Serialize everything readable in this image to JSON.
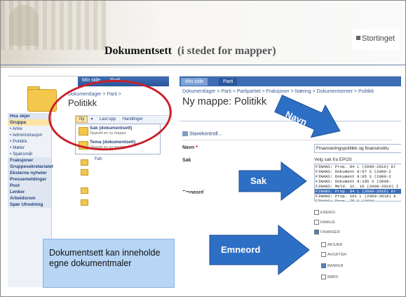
{
  "header": {
    "brand": "Stortinget",
    "title": "Dokumentsett",
    "subtitle": "(i stedet for mapper)"
  },
  "left_screenshot": {
    "tabs": [
      "Min side",
      "Parti"
    ],
    "breadcrumb": "Dokumentlager > Parti >",
    "page_title": "Politikk",
    "nav": [
      {
        "label": "Hva skjer",
        "kind": "head"
      },
      {
        "label": "Gruppa",
        "kind": "selected"
      },
      {
        "label": "• Arkiv",
        "kind": "item"
      },
      {
        "label": "• Administrasjon",
        "kind": "item"
      },
      {
        "label": "• Politikk",
        "kind": "item"
      },
      {
        "label": "• Møter",
        "kind": "item"
      },
      {
        "label": "• Spørsmål",
        "kind": "item"
      },
      {
        "label": "Fraksjoner",
        "kind": "head"
      },
      {
        "label": "Gruppesekretariatet",
        "kind": "head"
      },
      {
        "label": "Eksterne nyheter",
        "kind": "head"
      },
      {
        "label": "Pressemeldinger",
        "kind": "head"
      },
      {
        "label": "Post",
        "kind": "head"
      },
      {
        "label": "Lenker",
        "kind": "head"
      },
      {
        "label": "Arbeidsrom",
        "kind": "head"
      },
      {
        "label": "Spør Utredning",
        "kind": "head"
      }
    ],
    "toolbar": {
      "new": "Ny",
      "upload": "Last opp",
      "actions": "Handlinger"
    },
    "menu": [
      {
        "label": "Sak (dokumentsett)",
        "desc": "Opprett en ny mappe."
      },
      {
        "label": "Tema (dokumentsett)",
        "desc": "Opprett en ny mappe."
      }
    ],
    "list_header": "Felt"
  },
  "callout": {
    "text": "Dokumentsett kan inneholde egne dokumentmaler"
  },
  "right_screenshot": {
    "tabs": [
      "Min side",
      "Parti"
    ],
    "breadcrumb": "Dokumentlager > Parti > Partipartiet > Fraksjoner > Næring > Dokumentsenter > Politikk",
    "page_title": "Ny mappe: Politikk",
    "spellcheck": "Stavekontroll...",
    "fields": {
      "navn_label": "Navn",
      "navn_required": "*",
      "navn_value": "Finansieringspolitikk og finansinstitu",
      "sak_label": "Sak",
      "sak_hint": "Velg sak fra EPOS",
      "sak_items": [
        {
          "text": "FINANS: Prop. 84 L (2009-2010) Er",
          "selected": false
        },
        {
          "text": "FINANS: Dokument 8:67 S (2009-2",
          "selected": false
        },
        {
          "text": "FINANS: Dokument 8:85 S (2009-2",
          "selected": false
        },
        {
          "text": "FINANS: Dokument 8:105 S (2009-",
          "selected": false
        },
        {
          "text": "FINANS: Meld. St. 10 (2009-2010) I",
          "selected": false
        },
        {
          "text": "FINANS: Prop. 84 L (2009-2010) Er",
          "selected": true
        },
        {
          "text": "FINANS: Prop. 101 L (2009-2010) E",
          "selected": false
        },
        {
          "text": "FINANS: Prop. 75 S (2009-",
          "selected": false
        }
      ],
      "emneord_label": "Emneord",
      "tree": [
        {
          "label": "ENERGI",
          "checked": false
        },
        {
          "label": "FAMILIE",
          "checked": false
        },
        {
          "label": "FINANSER",
          "checked": true
        },
        {
          "label": "AKSJER",
          "checked": false
        },
        {
          "label": "AVGIFTER",
          "checked": false
        },
        {
          "label": "BANKER",
          "checked": true
        },
        {
          "label": "BØRS",
          "checked": false
        }
      ]
    }
  },
  "arrows": {
    "navn": "Navn",
    "sak": "Sak",
    "emneord": "Emneord",
    "color": "#2d6fc4"
  }
}
